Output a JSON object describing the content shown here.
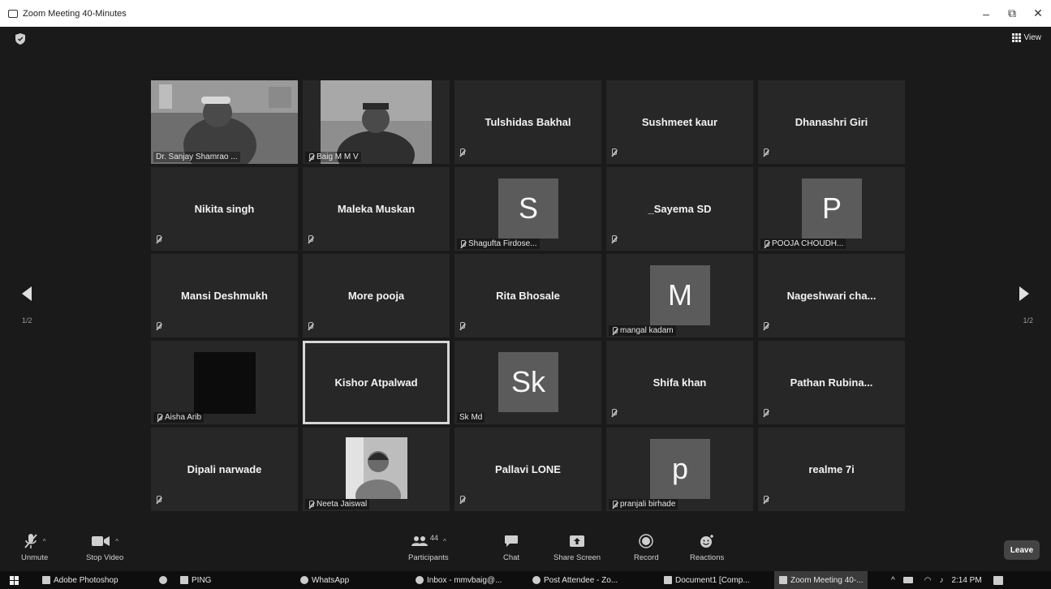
{
  "window": {
    "title": "Zoom Meeting 40-Minutes",
    "minimize": "–",
    "restore": "⧉",
    "close": "✕"
  },
  "topbar": {
    "view_label": "View"
  },
  "pager": {
    "left": "1/2",
    "right": "1/2"
  },
  "tiles": [
    {
      "kind": "video",
      "caption": "Dr. Sanjay Shamrao ...",
      "muted": false
    },
    {
      "kind": "video",
      "caption": "Baig M M V",
      "muted": true
    },
    {
      "kind": "name",
      "name": "Tulshidas Bakhal",
      "muted": true
    },
    {
      "kind": "name",
      "name": "Sushmeet kaur",
      "muted": true
    },
    {
      "kind": "name",
      "name": "Dhanashri Giri",
      "muted": true
    },
    {
      "kind": "name",
      "name": "Nikita singh",
      "muted": true
    },
    {
      "kind": "name",
      "name": "Maleka Muskan",
      "muted": true
    },
    {
      "kind": "avatar",
      "letter": "S",
      "caption": "Shagufta Firdose...",
      "muted": true
    },
    {
      "kind": "name",
      "name": "_Sayema SD",
      "muted": true
    },
    {
      "kind": "avatar",
      "letter": "P",
      "caption": "POOJA CHOUDH...",
      "muted": true
    },
    {
      "kind": "name",
      "name": "Mansi Deshmukh",
      "muted": true
    },
    {
      "kind": "name",
      "name": "More pooja",
      "muted": true
    },
    {
      "kind": "name",
      "name": "Rita Bhosale",
      "muted": true
    },
    {
      "kind": "avatar",
      "letter": "M",
      "caption": "mangal kadam",
      "muted": true
    },
    {
      "kind": "name",
      "name": "Nageshwari cha...",
      "muted": true
    },
    {
      "kind": "dark",
      "caption": "Aisha Arib",
      "muted": true
    },
    {
      "kind": "name",
      "name": "Kishor Atpalwad",
      "muted": false,
      "active": true
    },
    {
      "kind": "avatar",
      "letter": "Sk",
      "caption": "Sk Md",
      "muted": false
    },
    {
      "kind": "name",
      "name": "Shifa khan",
      "muted": true
    },
    {
      "kind": "name",
      "name": "Pathan Rubina...",
      "muted": true
    },
    {
      "kind": "name",
      "name": "Dipali narwade",
      "muted": true
    },
    {
      "kind": "video-small",
      "caption": "Neeta Jaiswal",
      "muted": true
    },
    {
      "kind": "name",
      "name": "Pallavi LONE",
      "muted": true
    },
    {
      "kind": "avatar",
      "letter": "p",
      "caption": "pranjali birhade",
      "muted": true
    },
    {
      "kind": "name",
      "name": "realme 7i",
      "muted": true
    }
  ],
  "toolbar": {
    "unmute": "Unmute",
    "stop_video": "Stop Video",
    "participants": "Participants",
    "participants_count": "44",
    "chat": "Chat",
    "share_screen": "Share Screen",
    "record": "Record",
    "reactions": "Reactions",
    "leave": "Leave"
  },
  "taskbar": {
    "items": [
      "Adobe Photoshop",
      "PING",
      "WhatsApp",
      "Inbox - mmvbaig@...",
      "Post Attendee - Zo...",
      "Document1 [Comp...",
      "Zoom Meeting 40-..."
    ],
    "time": "2:14 PM"
  }
}
